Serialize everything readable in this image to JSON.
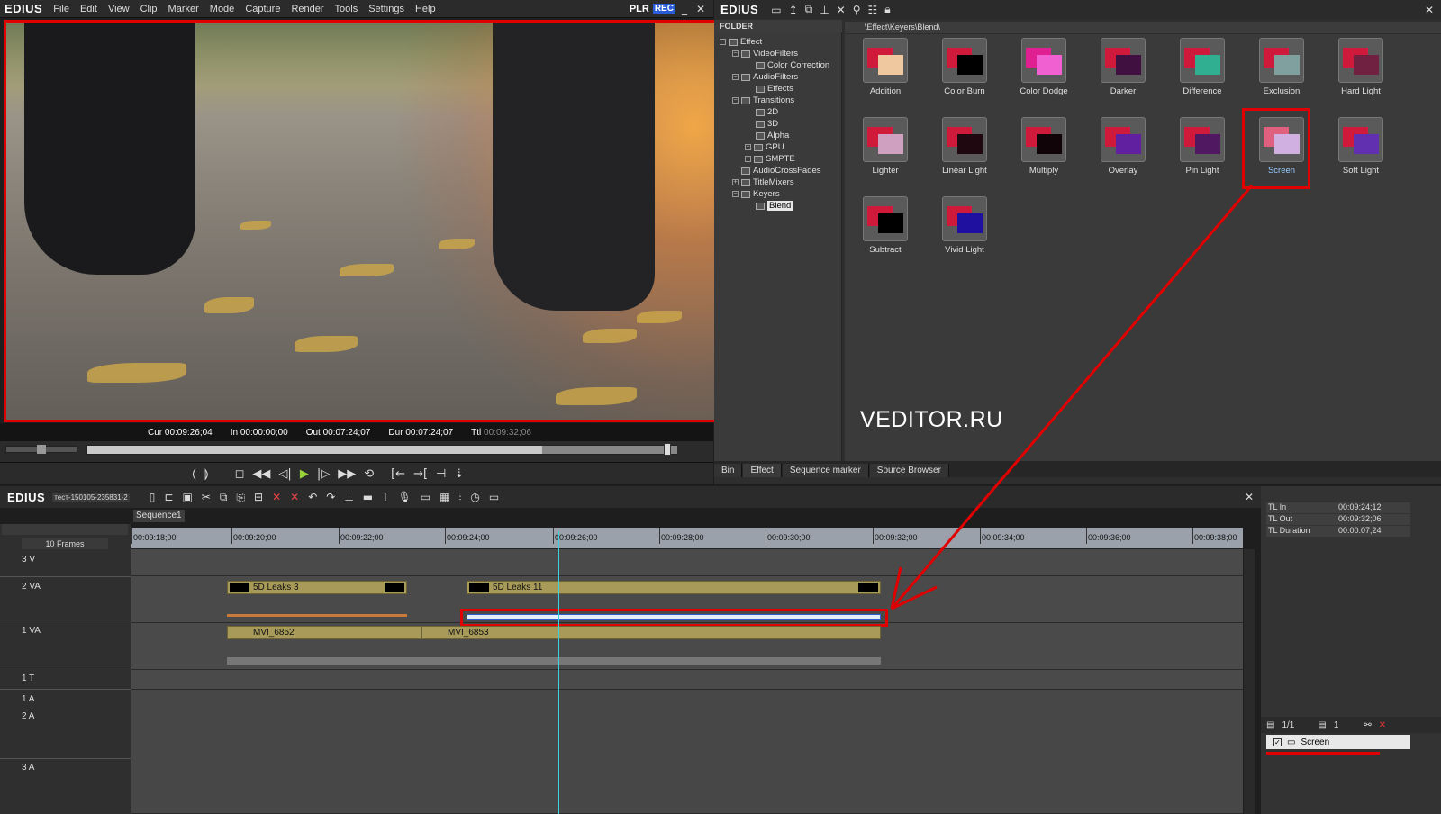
{
  "app": {
    "logo": "EDIUS",
    "menu": [
      "File",
      "Edit",
      "View",
      "Clip",
      "Marker",
      "Mode",
      "Capture",
      "Render",
      "Tools",
      "Settings",
      "Help"
    ],
    "plr": "PLR",
    "rec": "REC",
    "minimize": "_",
    "close": "✕"
  },
  "player": {
    "cur_label": "Cur",
    "cur": "00:09:26;04",
    "in_label": "In",
    "in": "00:00:00;00",
    "out_label": "Out",
    "out": "00:07:24;07",
    "dur_label": "Dur",
    "dur": "00:07:24;07",
    "ttl_label": "Ttl",
    "ttl": "00:09:32;06"
  },
  "effect_panel": {
    "logo": "EDIUS",
    "folder_header": "FOLDER",
    "path": "\\Effect\\Keyers\\Blend\\",
    "tree": [
      "Effect",
      "VideoFilters",
      "Color Correction",
      "AudioFilters",
      "Effects",
      "Transitions",
      "2D",
      "3D",
      "Alpha",
      "GPU",
      "SMPTE",
      "AudioCrossFades",
      "TitleMixers",
      "Keyers",
      "Blend"
    ],
    "effects": [
      "Addition",
      "Color Burn",
      "Color Dodge",
      "Darker",
      "Difference",
      "Exclusion",
      "Hard Light",
      "Lighter",
      "Linear Light",
      "Multiply",
      "Overlay",
      "Pin Light",
      "Screen",
      "Soft Light",
      "Subtract",
      "Vivid Light"
    ],
    "selected_effect": "Screen",
    "tabs": [
      "Bin",
      "Effect",
      "Sequence marker",
      "Source Browser"
    ],
    "watermark": "VEDITOR.RU"
  },
  "timeline": {
    "logo": "EDIUS",
    "project": "тест-150105-235831-2",
    "sequence_tab": "Sequence1",
    "frames": "10 Frames",
    "ruler": [
      "00:09:18;00",
      "00:09:20;00",
      "00:09:22;00",
      "00:09:24;00",
      "00:09:26;00",
      "00:09:28;00",
      "00:09:30;00",
      "00:09:32;00",
      "00:09:34;00",
      "00:09:36;00",
      "00:09:38;00"
    ],
    "tracks": [
      "3 V",
      "2 VA",
      "1 VA",
      "1 T",
      "1 A",
      "2 A",
      "3 A"
    ],
    "clips": {
      "leaks3": "5D Leaks 3",
      "leaks11": "5D Leaks 11",
      "mvi6852": "MVI_6852",
      "mvi6853": "MVI_6853"
    }
  },
  "info_panel": {
    "tl_in_label": "TL In",
    "tl_in": "00:09:24;12",
    "tl_out_label": "TL Out",
    "tl_out": "00:09:32;06",
    "tl_dur_label": "TL Duration",
    "tl_dur": "00:00:07;24",
    "page": "1/1",
    "count": "1",
    "layer_effect": "Screen"
  },
  "colors": {
    "highlight": "#e00000",
    "playhead": "#3bd1e0",
    "clip": "#a89b5a",
    "rec": "#2a5cd8"
  }
}
